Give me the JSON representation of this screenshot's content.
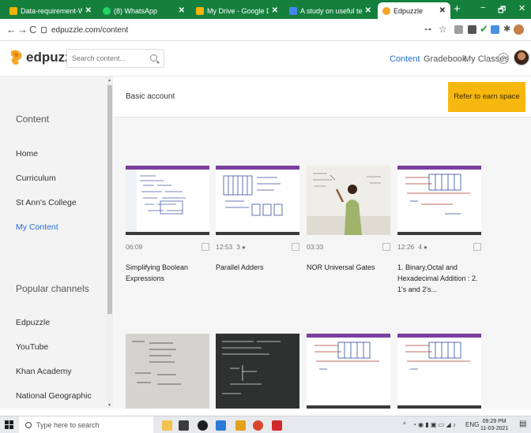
{
  "browser": {
    "tabs": [
      {
        "label": "Data-requirement-Website-w",
        "color": "#f4b400"
      },
      {
        "label": "(8) WhatsApp",
        "color": "#25d366"
      },
      {
        "label": "My Drive - Google Drive",
        "color": "#f4b400"
      },
      {
        "label": "A study on useful technologie",
        "color": "#4285f4"
      },
      {
        "label": "Edpuzzle",
        "color": "#f6a623"
      }
    ],
    "url": "edpuzzle.com/content",
    "new_tab_glyph": "+",
    "window_controls": [
      "−",
      "🗗",
      "✕"
    ]
  },
  "header": {
    "logo_text": "edpuzzle",
    "search_placeholder": "Search content...",
    "nav": [
      "Content",
      "Gradebook",
      "My Classes"
    ],
    "help_glyph": "?"
  },
  "sidebar": {
    "section_content": "Content",
    "content_items": [
      "Home",
      "Curriculum",
      "St Ann's College",
      "My Content"
    ],
    "section_popular": "Popular channels",
    "channel_items": [
      "Edpuzzle",
      "YouTube",
      "Khan Academy",
      "National Geographic"
    ]
  },
  "banner": {
    "title": "Basic account",
    "refer_button": "Refer to earn space"
  },
  "videos": [
    {
      "duration": "06:09",
      "questions": "",
      "title": "Simplifying Boolean Expressions"
    },
    {
      "duration": "12:53",
      "questions": "3",
      "title": "Parallel Adders"
    },
    {
      "duration": "03:33",
      "questions": "",
      "title": "NOR Universal Gates"
    },
    {
      "duration": "12:26",
      "questions": "4",
      "title": "1. Binary,Octal and Hexadecimal Addition : 2. 1's and 2's..."
    }
  ],
  "taskbar": {
    "search_placeholder": "Type here to search",
    "lang": "ENG",
    "time": "09:29 PM",
    "date": "11-03-2021"
  }
}
